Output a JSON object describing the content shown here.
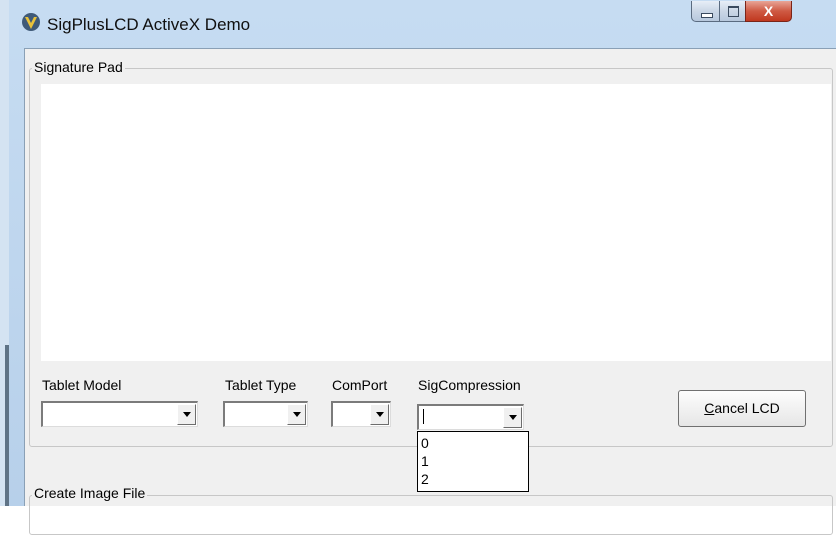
{
  "window": {
    "title": "SigPlusLCD ActiveX Demo",
    "icon": "sigplus-app-icon"
  },
  "caption_buttons": {
    "minimize_icon": "minimize-icon",
    "maximize_icon": "maximize-icon",
    "close_icon": "close-icon",
    "close_glyph": "X"
  },
  "signature_group": {
    "label": "Signature Pad"
  },
  "controls": {
    "tablet_model": {
      "label": "Tablet Model",
      "value": ""
    },
    "tablet_type": {
      "label": "Tablet Type",
      "value": ""
    },
    "comport": {
      "label": "ComPort",
      "value": ""
    },
    "sig_compression": {
      "label": "SigCompression",
      "value": "",
      "options": [
        "0",
        "1",
        "2"
      ]
    },
    "cancel_button": {
      "mnemonic": "C",
      "rest": "ancel LCD"
    }
  },
  "image_group": {
    "label": "Create Image File"
  },
  "colors": {
    "client_bg": "#f0f0f0",
    "signature_bg": "#ffffff",
    "close_red": "#c0381f"
  }
}
